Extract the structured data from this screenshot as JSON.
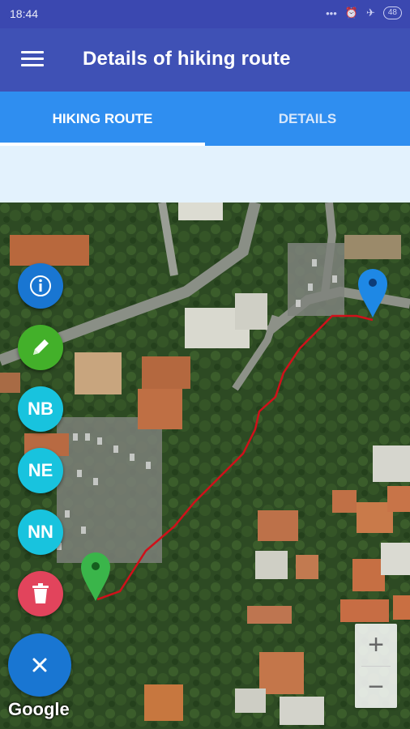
{
  "status": {
    "time": "18:44",
    "icons": [
      "dots-icon",
      "alarm-icon",
      "airplane-icon"
    ],
    "battery": "48"
  },
  "appbar": {
    "title": "Details of hiking route"
  },
  "tabs": [
    {
      "label": "HIKING ROUTE",
      "active": true
    },
    {
      "label": "DETAILS",
      "active": false
    }
  ],
  "fabs": {
    "info": {
      "icon": "info-icon",
      "color": "#1976d2"
    },
    "edit": {
      "icon": "pencil-icon",
      "color": "#43b02a"
    },
    "nb": {
      "label": "NB",
      "color": "#18c3de"
    },
    "ne": {
      "label": "NE",
      "color": "#18c3de"
    },
    "nn": {
      "label": "NN",
      "color": "#18c3de"
    },
    "delete": {
      "icon": "trash-icon",
      "color": "#e2445c"
    },
    "close": {
      "icon": "close-icon",
      "color": "#1976d2"
    }
  },
  "map": {
    "start_marker_color": "#3ab54a",
    "end_marker_color": "#1e88e5",
    "route_color": "#d0101a",
    "attribution": "Google",
    "zoom_in": "+",
    "zoom_out": "−"
  }
}
